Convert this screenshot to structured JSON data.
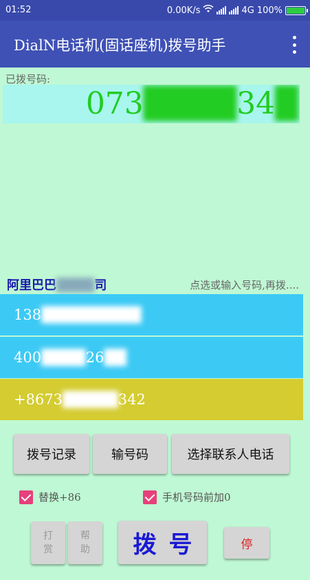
{
  "status_bar": {
    "time": "01:52",
    "network_speed": "0.00K/s",
    "network_type": "4G",
    "battery": "100%",
    "battery_level": 1.0
  },
  "app_bar": {
    "title": "DialN电话机(固话座机)拨号助手"
  },
  "dialed": {
    "label": "已拨号码:",
    "number_visible_start": "073",
    "number_hidden": "████",
    "number_visible_end": "34",
    "number_hidden_tail": "█"
  },
  "contact": {
    "company_visible": "阿里巴巴",
    "company_hidden": "████",
    "company_tail": "司",
    "hint": "点选或输入号码,再拨...."
  },
  "numbers": [
    {
      "visible": "138",
      "hidden": "█████████"
    },
    {
      "visible": "400",
      "hidden": "████",
      "mid": "26",
      "tail": "██"
    },
    {
      "visible": "+8673",
      "hidden": "█████",
      "mid": "342",
      "tail": ""
    }
  ],
  "buttons": {
    "history": "拨号记录",
    "input": "输号码",
    "select_contact": "选择联系人电话",
    "tip_line1": "打",
    "tip_line2": "赏",
    "help_line1": "帮",
    "help_line2": "助",
    "dial": "拨号",
    "stop": "停"
  },
  "options": {
    "replace_86": "替换+86",
    "mobile_prefix_0": "手机号码前加0"
  },
  "colors": {
    "status_bar": "#3949ab",
    "app_bar": "#3f51b5",
    "background": "#bff8d4",
    "number_box": "#a8f6ee",
    "number_text": "#22cc22",
    "row_blue": "#3ccaf5",
    "row_gold": "#d4cc30",
    "checkbox": "#e6407a",
    "dial_text": "#1a1ad4",
    "stop_text": "#e02020"
  }
}
